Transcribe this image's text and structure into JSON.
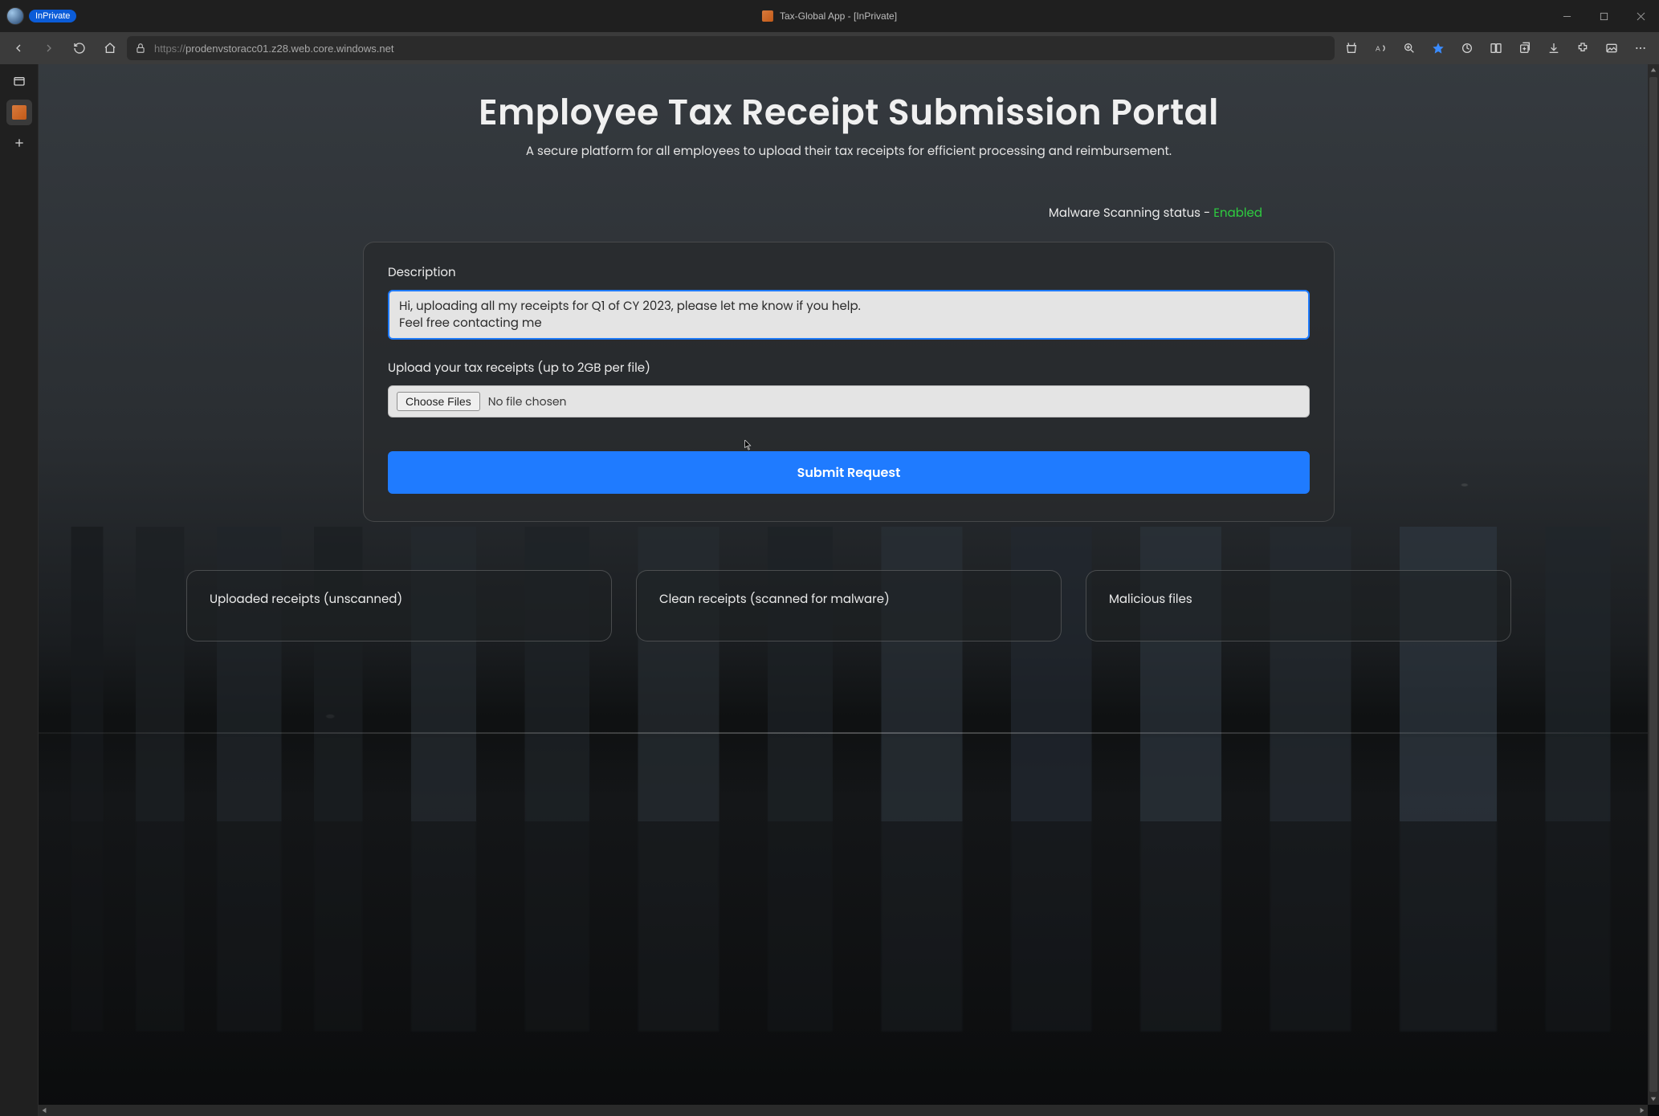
{
  "browser": {
    "inprivate_label": "InPrivate",
    "tab_title": "Tax-Global App - [InPrivate]",
    "url_proto": "https://",
    "url_rest": "prodenvstoracc01.z28.web.core.windows.net"
  },
  "page": {
    "title": "Employee Tax Receipt Submission Portal",
    "subtitle": "A secure platform for all employees to upload their tax receipts for efficient processing and reimbursement.",
    "scan_status_prefix": "Malware Scanning status - ",
    "scan_status_value": "Enabled"
  },
  "form": {
    "description_label": "Description",
    "description_value": "Hi, uploading all my receipts for Q1 of CY 2023, please let me know if you help.\nFeel free contacting me",
    "upload_label": "Upload your tax receipts (up to 2GB per file)",
    "choose_files_label": "Choose Files",
    "file_status": "No file chosen",
    "submit_label": "Submit Request"
  },
  "panels": {
    "uploaded": "Uploaded receipts (unscanned)",
    "clean": "Clean receipts (scanned for malware)",
    "malicious": "Malicious files"
  }
}
